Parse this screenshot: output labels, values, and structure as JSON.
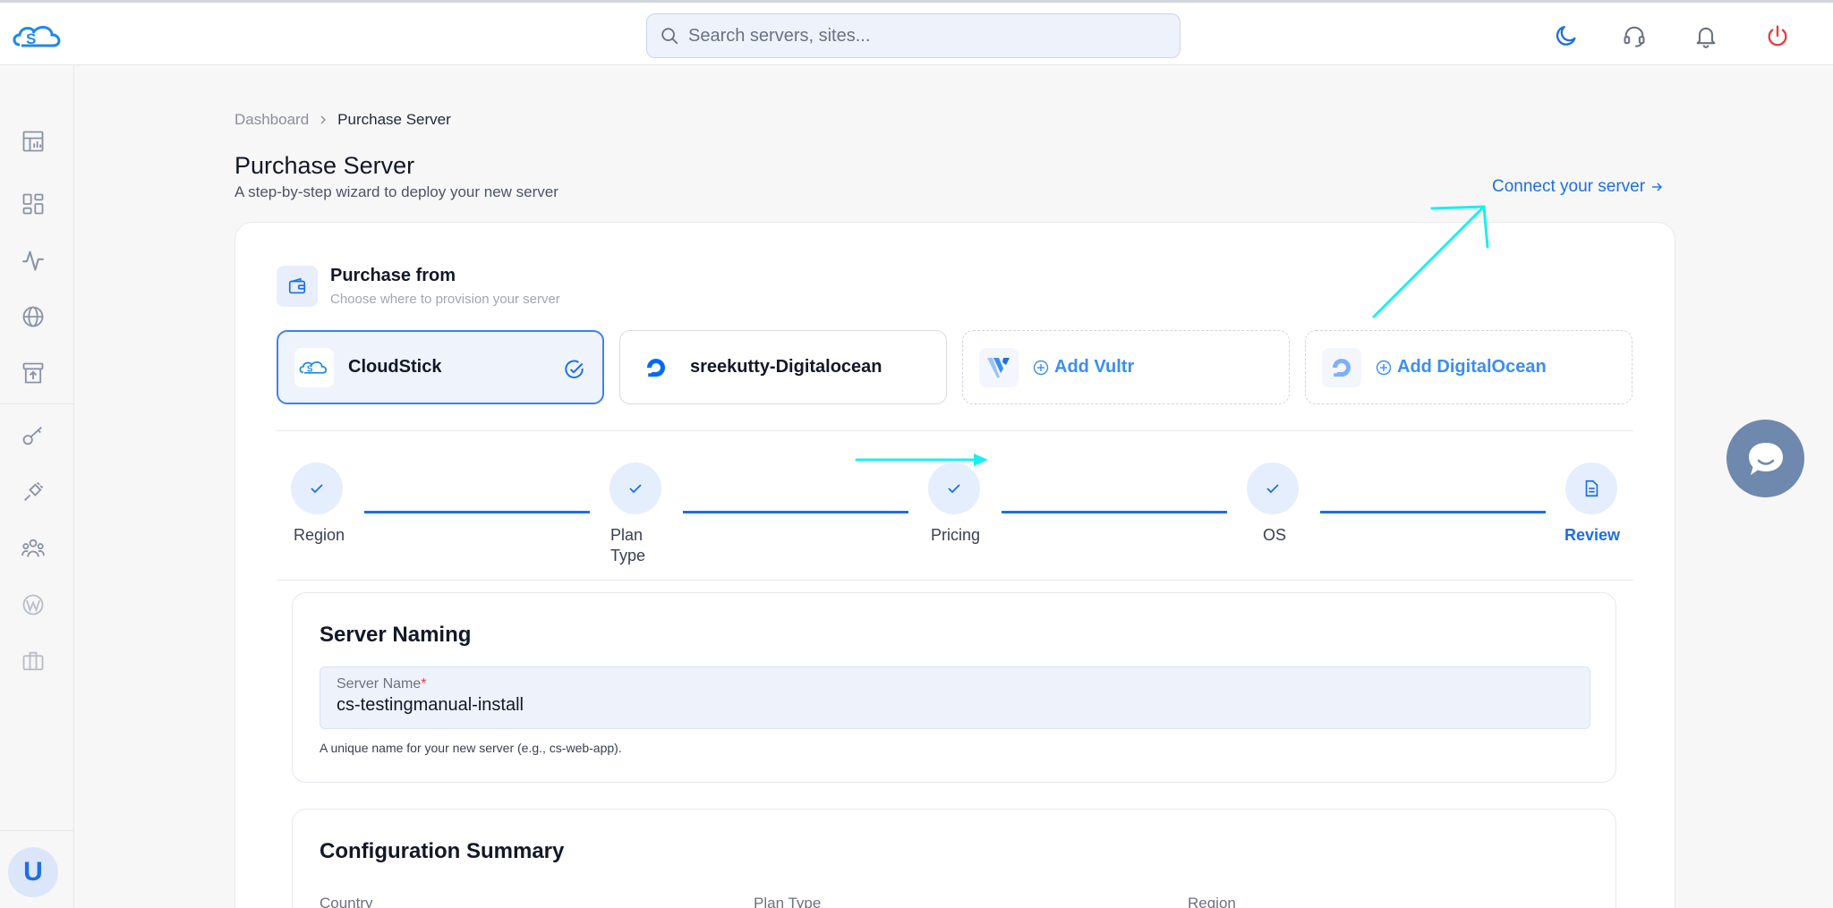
{
  "topbar": {
    "search_placeholder": "Search servers, sites...",
    "icons": [
      "cloudstick-logo",
      "moon-icon",
      "headset-icon",
      "bell-icon",
      "power-icon"
    ]
  },
  "sidebar": {
    "icons": [
      "dashboard-chart-icon",
      "grid-icon",
      "activity-icon",
      "globe-icon",
      "archive-upload-icon",
      "key-icon",
      "plug-icon",
      "users-icon",
      "wordpress-icon",
      "briefcase-icon"
    ],
    "avatar_letter": "U"
  },
  "breadcrumb": {
    "parent": "Dashboard",
    "current": "Purchase Server"
  },
  "page": {
    "title": "Purchase Server",
    "subtitle": "A step-by-step wizard to deploy your new server",
    "connect_link": "Connect your server"
  },
  "purchase_from": {
    "title": "Purchase from",
    "subtitle": "Choose where to provision your server",
    "providers": [
      {
        "label": "CloudStick",
        "state": "selected"
      },
      {
        "label": "sreekutty-Digitalocean",
        "state": "available"
      },
      {
        "label": "Add Vultr",
        "state": "add"
      },
      {
        "label": "Add DigitalOcean",
        "state": "add"
      }
    ]
  },
  "steps": [
    {
      "label": "Region",
      "done": true
    },
    {
      "label": "Plan Type",
      "done": true
    },
    {
      "label": "Pricing",
      "done": true
    },
    {
      "label": "OS",
      "done": true
    },
    {
      "label": "Review",
      "done": false,
      "active": true
    }
  ],
  "server_naming": {
    "title": "Server Naming",
    "field_label": "Server Name",
    "field_required": "*",
    "field_value": "cs-testingmanual-install",
    "help": "A unique name for your new server (e.g., cs-web-app)."
  },
  "summary": {
    "title": "Configuration Summary",
    "columns": [
      "Country",
      "Plan Type",
      "Region"
    ]
  },
  "colors": {
    "accent": "#1d6fe0",
    "danger": "#e53e3e",
    "annotation": "#19f0ee"
  }
}
